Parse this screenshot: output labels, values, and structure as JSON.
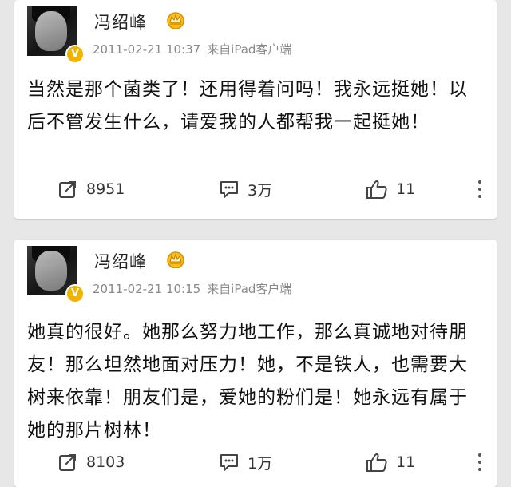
{
  "posts": [
    {
      "author": "冯绍峰",
      "date": "2011-02-21 10:37",
      "source": "来自iPad客户端",
      "text": "当然是那个菌类了！还用得着问吗！我永远挺她！以后不管发生什么，请爱我的人都帮我一起挺她！",
      "reposts": "8951",
      "comments": "3万",
      "likes": "11"
    },
    {
      "author": "冯绍峰",
      "date": "2011-02-21 10:15",
      "source": "来自iPad客户端",
      "text": "她真的很好。她那么努力地工作，那么真诚地对待朋友！那么坦然地面对压力！她，不是铁人，也需要大树来依靠！朋友们是，爱她的粉们是！她永远有属于她的那片树林！",
      "reposts": "8103",
      "comments": "1万",
      "likes": "11"
    }
  ],
  "colors": {
    "background": "#e7e7e7",
    "card": "#ffffff",
    "verified_badge": "#f0b400",
    "crown": "#f2b000"
  },
  "icons": {
    "repost": "repost-icon",
    "comment": "comment-icon",
    "like": "thumbs-up-icon",
    "more": "more-vertical-icon",
    "vip": "crown-icon",
    "verified": "verified-v-icon"
  }
}
